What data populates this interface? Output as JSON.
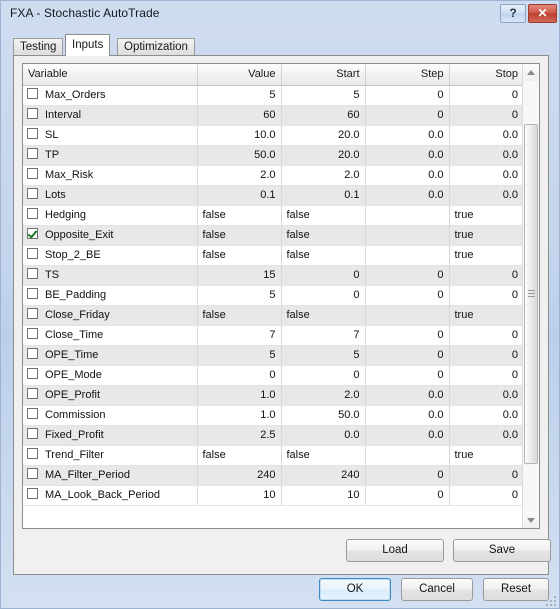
{
  "window": {
    "title": "FXA - Stochastic AutoTrade",
    "help_label": "?",
    "close_label": "✕"
  },
  "tabs": [
    {
      "label": "Testing",
      "active": false
    },
    {
      "label": "Inputs",
      "active": true
    },
    {
      "label": "Optimization",
      "active": false
    }
  ],
  "grid": {
    "columns": [
      "Variable",
      "Value",
      "Start",
      "Step",
      "Stop"
    ],
    "rows": [
      {
        "checked": false,
        "variable": "Max_Orders",
        "value": "5",
        "start": "5",
        "step": "0",
        "stop": "0",
        "bool": false
      },
      {
        "checked": false,
        "variable": "Interval",
        "value": "60",
        "start": "60",
        "step": "0",
        "stop": "0",
        "bool": false
      },
      {
        "checked": false,
        "variable": "SL",
        "value": "10.0",
        "start": "20.0",
        "step": "0.0",
        "stop": "0.0",
        "bool": false
      },
      {
        "checked": false,
        "variable": "TP",
        "value": "50.0",
        "start": "20.0",
        "step": "0.0",
        "stop": "0.0",
        "bool": false
      },
      {
        "checked": false,
        "variable": "Max_Risk",
        "value": "2.0",
        "start": "2.0",
        "step": "0.0",
        "stop": "0.0",
        "bool": false
      },
      {
        "checked": false,
        "variable": "Lots",
        "value": "0.1",
        "start": "0.1",
        "step": "0.0",
        "stop": "0.0",
        "bool": false
      },
      {
        "checked": false,
        "variable": "Hedging",
        "value": "false",
        "start": "false",
        "step": "",
        "stop": "true",
        "bool": true
      },
      {
        "checked": true,
        "variable": "Opposite_Exit",
        "value": "false",
        "start": "false",
        "step": "",
        "stop": "true",
        "bool": true
      },
      {
        "checked": false,
        "variable": "Stop_2_BE",
        "value": "false",
        "start": "false",
        "step": "",
        "stop": "true",
        "bool": true
      },
      {
        "checked": false,
        "variable": "TS",
        "value": "15",
        "start": "0",
        "step": "0",
        "stop": "0",
        "bool": false
      },
      {
        "checked": false,
        "variable": "BE_Padding",
        "value": "5",
        "start": "0",
        "step": "0",
        "stop": "0",
        "bool": false
      },
      {
        "checked": false,
        "variable": "Close_Friday",
        "value": "false",
        "start": "false",
        "step": "",
        "stop": "true",
        "bool": true
      },
      {
        "checked": false,
        "variable": "Close_Time",
        "value": "7",
        "start": "7",
        "step": "0",
        "stop": "0",
        "bool": false
      },
      {
        "checked": false,
        "variable": "OPE_Time",
        "value": "5",
        "start": "5",
        "step": "0",
        "stop": "0",
        "bool": false
      },
      {
        "checked": false,
        "variable": "OPE_Mode",
        "value": "0",
        "start": "0",
        "step": "0",
        "stop": "0",
        "bool": false
      },
      {
        "checked": false,
        "variable": "OPE_Profit",
        "value": "1.0",
        "start": "2.0",
        "step": "0.0",
        "stop": "0.0",
        "bool": false
      },
      {
        "checked": false,
        "variable": "Commission",
        "value": "1.0",
        "start": "50.0",
        "step": "0.0",
        "stop": "0.0",
        "bool": false
      },
      {
        "checked": false,
        "variable": "Fixed_Profit",
        "value": "2.5",
        "start": "0.0",
        "step": "0.0",
        "stop": "0.0",
        "bool": false
      },
      {
        "checked": false,
        "variable": "Trend_Filter",
        "value": "false",
        "start": "false",
        "step": "",
        "stop": "true",
        "bool": true
      },
      {
        "checked": false,
        "variable": "MA_Filter_Period",
        "value": "240",
        "start": "240",
        "step": "0",
        "stop": "0",
        "bool": false
      },
      {
        "checked": false,
        "variable": "MA_Look_Back_Period",
        "value": "10",
        "start": "10",
        "step": "0",
        "stop": "0",
        "bool": false
      }
    ]
  },
  "panel_buttons": {
    "load": "Load",
    "save": "Save"
  },
  "dialog_buttons": {
    "ok": "OK",
    "cancel": "Cancel",
    "reset": "Reset"
  },
  "colors": {
    "titlebar_accent": "#c3d4ec",
    "close_button": "#bc3e2d",
    "checkmark": "#1d7a22",
    "default_button_focus": "#3c8bc4",
    "row_alt": "#e8e8e8"
  }
}
